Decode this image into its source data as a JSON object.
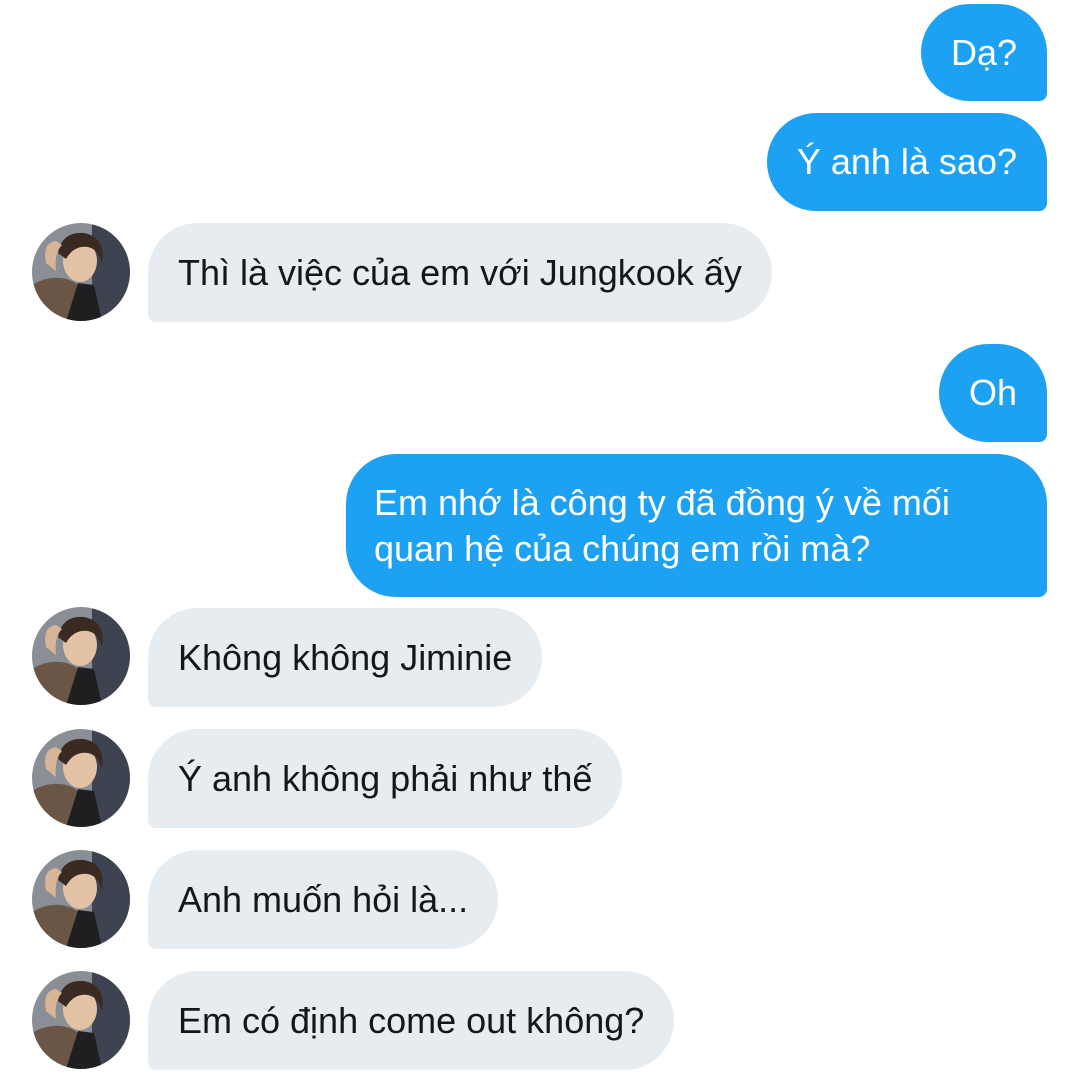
{
  "conversation": {
    "messages": [
      {
        "from": "me",
        "text": "Dạ?"
      },
      {
        "from": "me",
        "text": "Ý anh là sao?"
      },
      {
        "from": "other",
        "text": "Thì là việc của em với Jungkook ấy"
      },
      {
        "from": "me",
        "text": "Oh"
      },
      {
        "from": "me",
        "text": "Em nhớ là công ty đã đồng ý về mối quan hệ của chúng em rồi mà?"
      },
      {
        "from": "other",
        "text": "Không không Jiminie"
      },
      {
        "from": "other",
        "text": "Ý anh không phải như thế"
      },
      {
        "from": "other",
        "text": "Anh muốn hỏi là..."
      },
      {
        "from": "other",
        "text": "Em có định come out không?"
      }
    ]
  },
  "colors": {
    "outgoing_bubble": "#1da1f2",
    "incoming_bubble": "#e6ecf0",
    "incoming_text": "#14171a",
    "outgoing_text": "#ffffff"
  },
  "icons": {
    "avatar": "profile-photo-avatar"
  }
}
